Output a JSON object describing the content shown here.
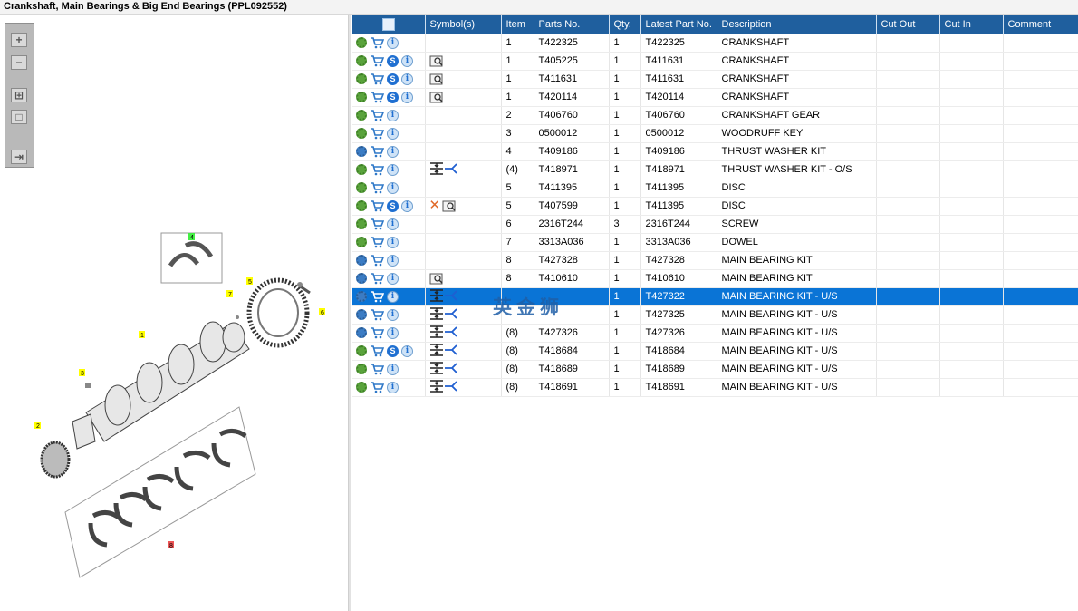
{
  "title": "Crankshaft, Main Bearings & Big End Bearings (PPL092552)",
  "toolbar": {
    "zoom_in": "+",
    "zoom_out": "−",
    "fit": "⊞",
    "actual": "□",
    "export": "⇥"
  },
  "diagram": {
    "callouts": [
      "1",
      "2",
      "3",
      "4",
      "5",
      "6",
      "7",
      "8"
    ]
  },
  "grid": {
    "columns": [
      "",
      "Symbol(s)",
      "Item",
      "Parts No.",
      "Qty.",
      "Latest Part No.",
      "Description",
      "Cut Out",
      "Cut In",
      "Comment"
    ],
    "rows": [
      {
        "icons": [
          "gear",
          "cart",
          "info"
        ],
        "symbols": [],
        "item": "1",
        "part": "T422325",
        "qty": "1",
        "latest": "T422325",
        "desc": "CRANKSHAFT"
      },
      {
        "icons": [
          "gear",
          "cart",
          "s",
          "info"
        ],
        "symbols": [
          "book"
        ],
        "item": "1",
        "part": "T405225",
        "qty": "1",
        "latest": "T411631",
        "desc": "CRANKSHAFT"
      },
      {
        "icons": [
          "gear",
          "cart",
          "s",
          "info"
        ],
        "symbols": [
          "book"
        ],
        "item": "1",
        "part": "T411631",
        "qty": "1",
        "latest": "T411631",
        "desc": "CRANKSHAFT"
      },
      {
        "icons": [
          "gear",
          "cart",
          "s",
          "info"
        ],
        "symbols": [
          "book"
        ],
        "item": "1",
        "part": "T420114",
        "qty": "1",
        "latest": "T420114",
        "desc": "CRANKSHAFT"
      },
      {
        "icons": [
          "gear",
          "cart",
          "info"
        ],
        "symbols": [],
        "item": "2",
        "part": "T406760",
        "qty": "1",
        "latest": "T406760",
        "desc": "CRANKSHAFT GEAR"
      },
      {
        "icons": [
          "gear",
          "cart",
          "info"
        ],
        "symbols": [],
        "item": "3",
        "part": "0500012",
        "qty": "1",
        "latest": "0500012",
        "desc": "WOODRUFF KEY"
      },
      {
        "icons": [
          "gears",
          "cart",
          "info"
        ],
        "symbols": [],
        "item": "4",
        "part": "T409186",
        "qty": "1",
        "latest": "T409186",
        "desc": "THRUST WASHER KIT"
      },
      {
        "icons": [
          "gear",
          "cart",
          "info"
        ],
        "symbols": [
          "measure"
        ],
        "item": "(4)",
        "part": "T418971",
        "qty": "1",
        "latest": "T418971",
        "desc": "THRUST WASHER KIT - O/S"
      },
      {
        "icons": [
          "gear",
          "cart",
          "info"
        ],
        "symbols": [],
        "item": "5",
        "part": "T411395",
        "qty": "1",
        "latest": "T411395",
        "desc": "DISC"
      },
      {
        "icons": [
          "gear",
          "cart",
          "s",
          "info"
        ],
        "symbols": [
          "x",
          "book"
        ],
        "item": "5",
        "part": "T407599",
        "qty": "1",
        "latest": "T411395",
        "desc": "DISC"
      },
      {
        "icons": [
          "gear",
          "cart",
          "info"
        ],
        "symbols": [],
        "item": "6",
        "part": "2316T244",
        "qty": "3",
        "latest": "2316T244",
        "desc": "SCREW"
      },
      {
        "icons": [
          "gear",
          "cart",
          "info"
        ],
        "symbols": [],
        "item": "7",
        "part": "3313A036",
        "qty": "1",
        "latest": "3313A036",
        "desc": "DOWEL"
      },
      {
        "icons": [
          "gears",
          "cart",
          "info"
        ],
        "symbols": [],
        "item": "8",
        "part": "T427328",
        "qty": "1",
        "latest": "T427328",
        "desc": "MAIN BEARING KIT"
      },
      {
        "icons": [
          "gears",
          "cart",
          "info"
        ],
        "symbols": [
          "book"
        ],
        "item": "8",
        "part": "T410610",
        "qty": "1",
        "latest": "T410610",
        "desc": "MAIN BEARING KIT"
      },
      {
        "icons": [
          "gears",
          "cart",
          "info"
        ],
        "symbols": [
          "measure"
        ],
        "item": "",
        "part": "",
        "qty": "1",
        "latest": "T427322",
        "desc": "MAIN BEARING KIT - U/S",
        "selected": true
      },
      {
        "icons": [
          "gears",
          "cart",
          "info"
        ],
        "symbols": [
          "measure"
        ],
        "item": "",
        "part": "",
        "qty": "1",
        "latest": "T427325",
        "desc": "MAIN BEARING KIT - U/S"
      },
      {
        "icons": [
          "gears",
          "cart",
          "info"
        ],
        "symbols": [
          "measure"
        ],
        "item": "(8)",
        "part": "T427326",
        "qty": "1",
        "latest": "T427326",
        "desc": "MAIN BEARING KIT - U/S"
      },
      {
        "icons": [
          "gear",
          "cart",
          "s",
          "info"
        ],
        "symbols": [
          "measure"
        ],
        "item": "(8)",
        "part": "T418684",
        "qty": "1",
        "latest": "T418684",
        "desc": "MAIN BEARING KIT - U/S"
      },
      {
        "icons": [
          "gear",
          "cart",
          "info"
        ],
        "symbols": [
          "measure"
        ],
        "item": "(8)",
        "part": "T418689",
        "qty": "1",
        "latest": "T418689",
        "desc": "MAIN BEARING KIT - U/S"
      },
      {
        "icons": [
          "gear",
          "cart",
          "info"
        ],
        "symbols": [
          "measure"
        ],
        "item": "(8)",
        "part": "T418691",
        "qty": "1",
        "latest": "T418691",
        "desc": "MAIN BEARING KIT - U/S"
      }
    ]
  },
  "watermark": "英金狮",
  "colors": {
    "header": "#1f5f9e",
    "selected": "#0a74d6",
    "gear": "#5aa33c",
    "callout": "#ffff00"
  }
}
